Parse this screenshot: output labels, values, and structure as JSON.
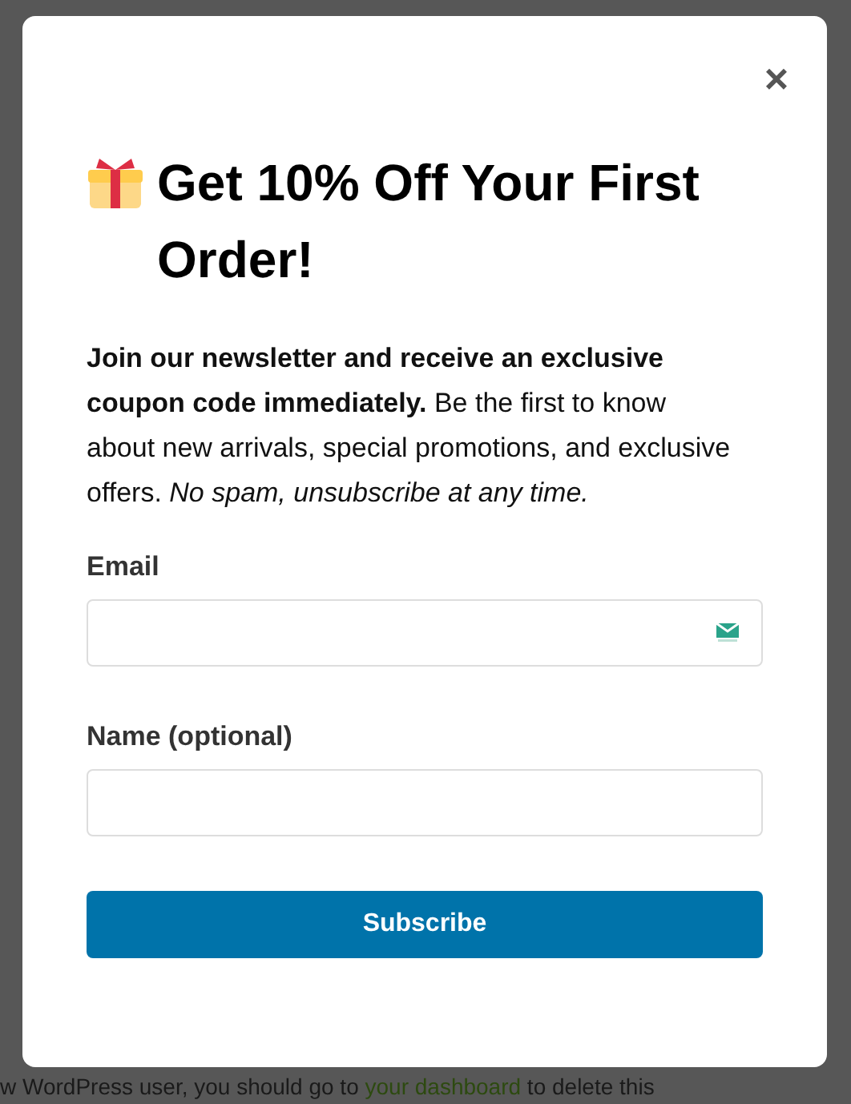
{
  "background": {
    "line": "w WordPress user, you should go to ",
    "link": "your dashboard",
    "line_end": " to delete this"
  },
  "modal": {
    "close": "×",
    "title": "Get 10% Off Your First Order!",
    "intro": "**Join our newsletter and receive an exclusive coupon code immediately.** Be the first to know about new arrivals, special promotions, and exclusive offers. *No spam, unsubscribe at any time.*",
    "fields": [
      {
        "label": "Email",
        "kind": "email"
      },
      {
        "label": "Name (optional)",
        "kind": "text"
      }
    ],
    "button": "Subscribe"
  }
}
